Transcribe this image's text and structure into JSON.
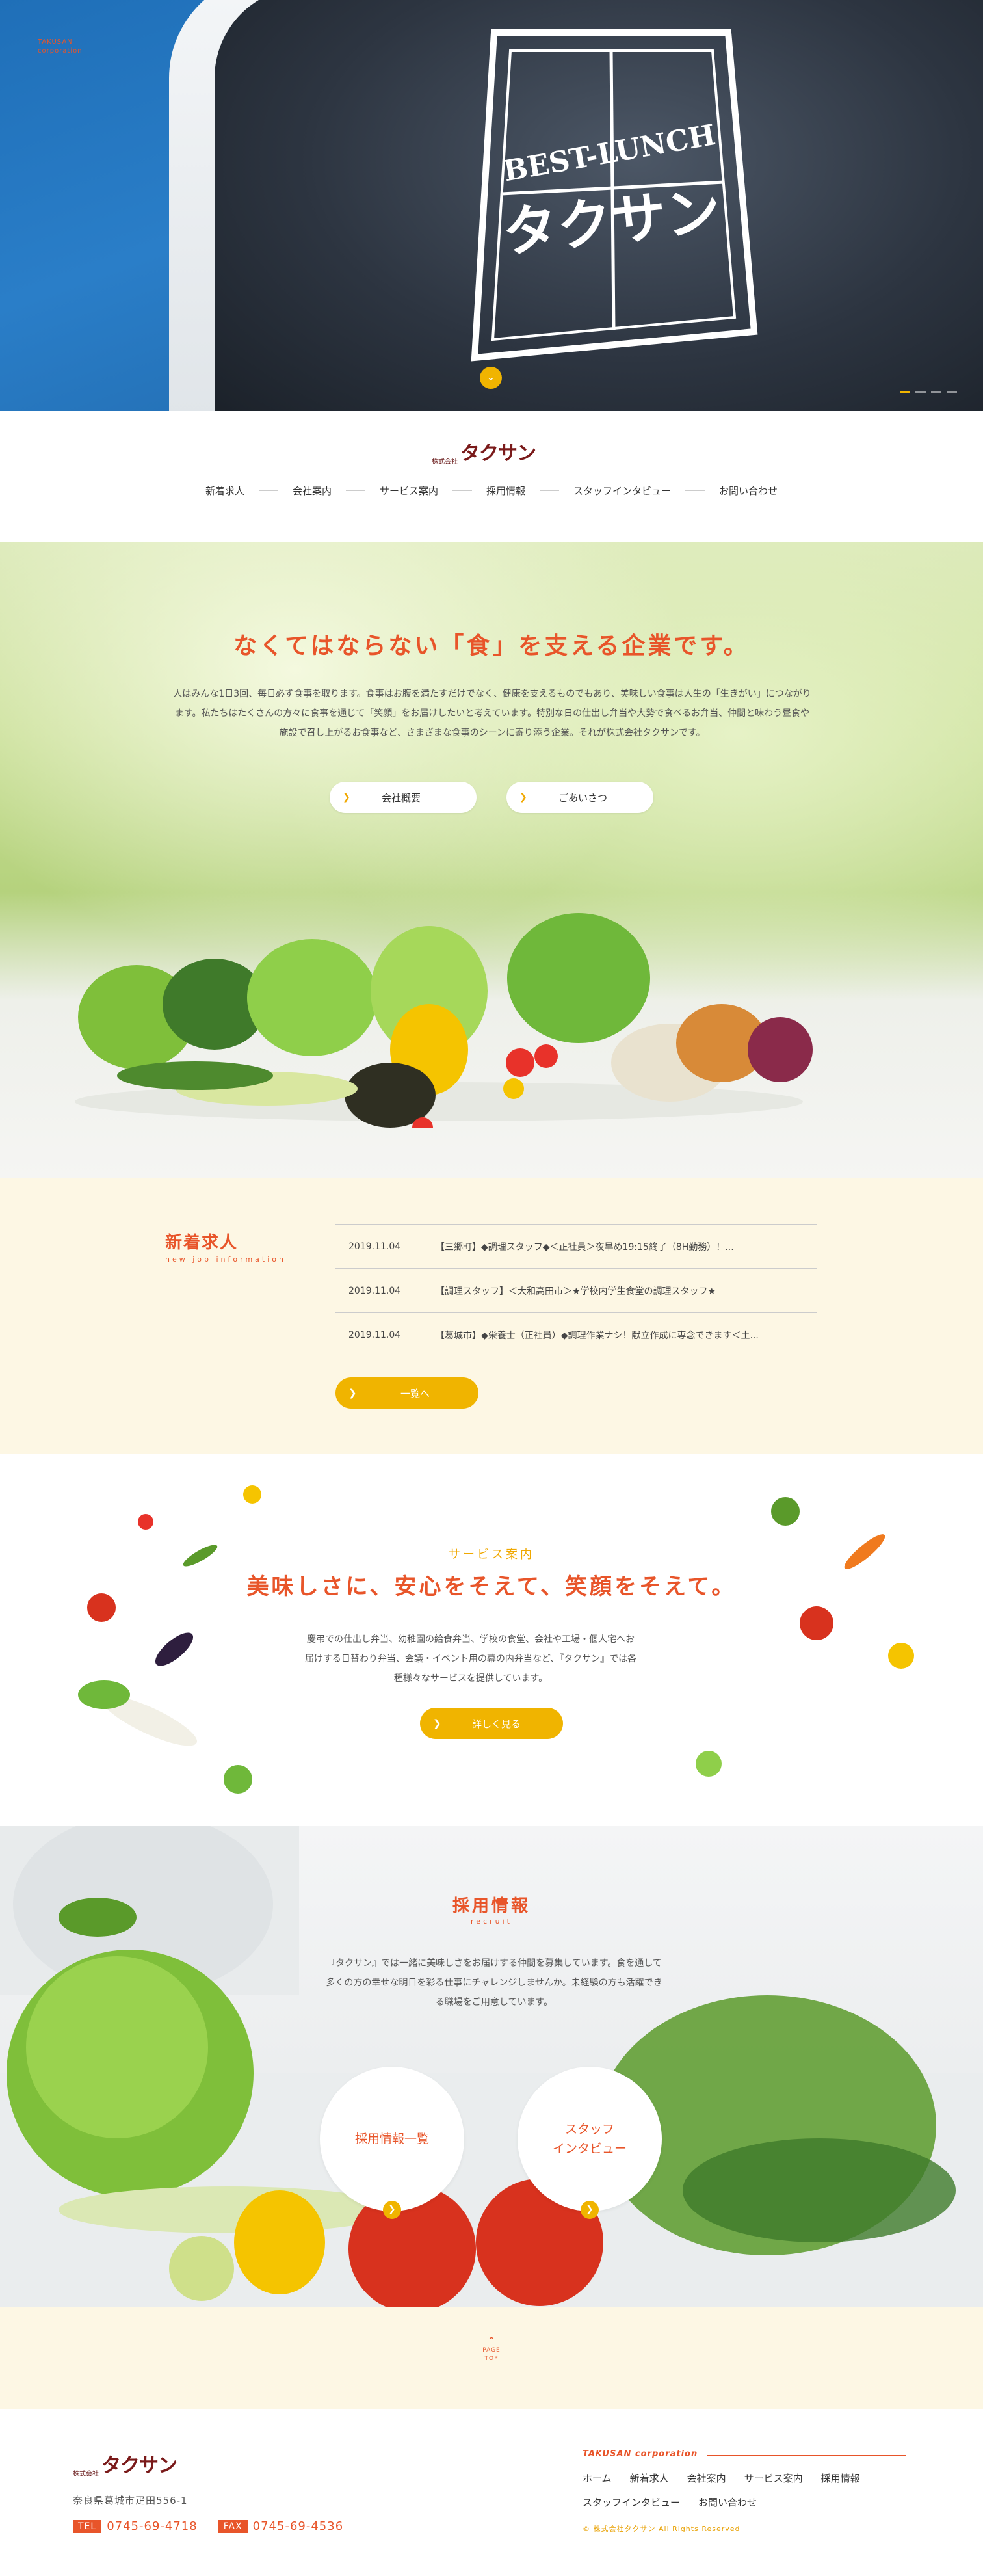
{
  "hero": {
    "brand_line1": "TAKUSAN",
    "brand_line2": "corporation",
    "badge_text": "BEST-LUNCH",
    "badge_kana": "タクサン",
    "scroll_icon": "chevron-down-icon",
    "slide_count": 4,
    "active_slide": 1
  },
  "header": {
    "logo_prefix": "株式会社",
    "logo_name": "タクサン",
    "nav": [
      "新着求人",
      "会社案内",
      "サービス案内",
      "採用情報",
      "スタッフインタビュー",
      "お問い合わせ"
    ]
  },
  "intro": {
    "title": "なくてはならない「食」を支える企業です。",
    "text": "人はみんな1日3回、毎日必ず食事を取ります。食事はお腹を満たすだけでなく、健康を支えるものでもあり、美味しい食事は人生の「生きがい」につながります。私たちはたくさんの方々に食事を通じて「笑顔」をお届けしたいと考えています。特別な日の仕出し弁当や大勢で食べるお弁当、仲間と味わう昼食や施設で召し上がるお食事など、さまざまな食事のシーンに寄り添う企業。それが株式会社タクサンです。",
    "buttons": [
      "会社概要",
      "ごあいさつ"
    ]
  },
  "news": {
    "title": "新着求人",
    "subtitle": "new job information",
    "items": [
      {
        "date": "2019.11.04",
        "text": "【三郷町】◆調理スタッフ◆＜正社員＞夜早め19:15終了（8H勤務）！..."
      },
      {
        "date": "2019.11.04",
        "text": "【調理スタッフ】＜大和高田市＞★学校内学生食堂の調理スタッフ★"
      },
      {
        "date": "2019.11.04",
        "text": "【葛城市】◆栄養士（正社員）◆調理作業ナシ！献立作成に専念できます＜土..."
      }
    ],
    "button": "一覧へ"
  },
  "service": {
    "subtitle": "サービス案内",
    "title": "美味しさに、安心をそえて、笑顔をそえて。",
    "text": "慶弔での仕出し弁当、幼稚園の給食弁当、学校の食堂、会社や工場・個人宅へお届けする日替わり弁当、会議・イベント用の幕の内弁当など、『タクサン』では各種様々なサービスを提供しています。",
    "button": "詳しく見る"
  },
  "recruit": {
    "title": "採用情報",
    "subtitle": "recruit",
    "text": "『タクサン』では一緒に美味しさをお届けする仲間を募集しています。食を通して多くの方の幸せな明日を彩る仕事にチャレンジしませんか。未経験の方も活躍できる職場をご用意しています。",
    "circle_list": "採用情報一覧",
    "circle_staff_line1": "スタッフ",
    "circle_staff_line2": "インタビュー"
  },
  "pagetop": {
    "label_line1": "PAGE",
    "label_line2": "TOP"
  },
  "footer": {
    "logo_prefix": "株式会社",
    "logo_name": "タクサン",
    "address": "奈良県葛城市疋田556-1",
    "tel_label": "TEL",
    "tel": "0745-69-4718",
    "fax_label": "FAX",
    "fax": "0745-69-4536",
    "brand": "TAKUSAN corporation",
    "links": [
      "ホーム",
      "新着求人",
      "会社案内",
      "サービス案内",
      "採用情報",
      "スタッフインタビュー",
      "お問い合わせ"
    ],
    "copyright": "© 株式会社タクサン All Rights Reserved"
  },
  "colors": {
    "accent": "#e8552a",
    "button": "#f0b400",
    "cream": "#fdf7e4",
    "brand": "#7a1a1a"
  }
}
